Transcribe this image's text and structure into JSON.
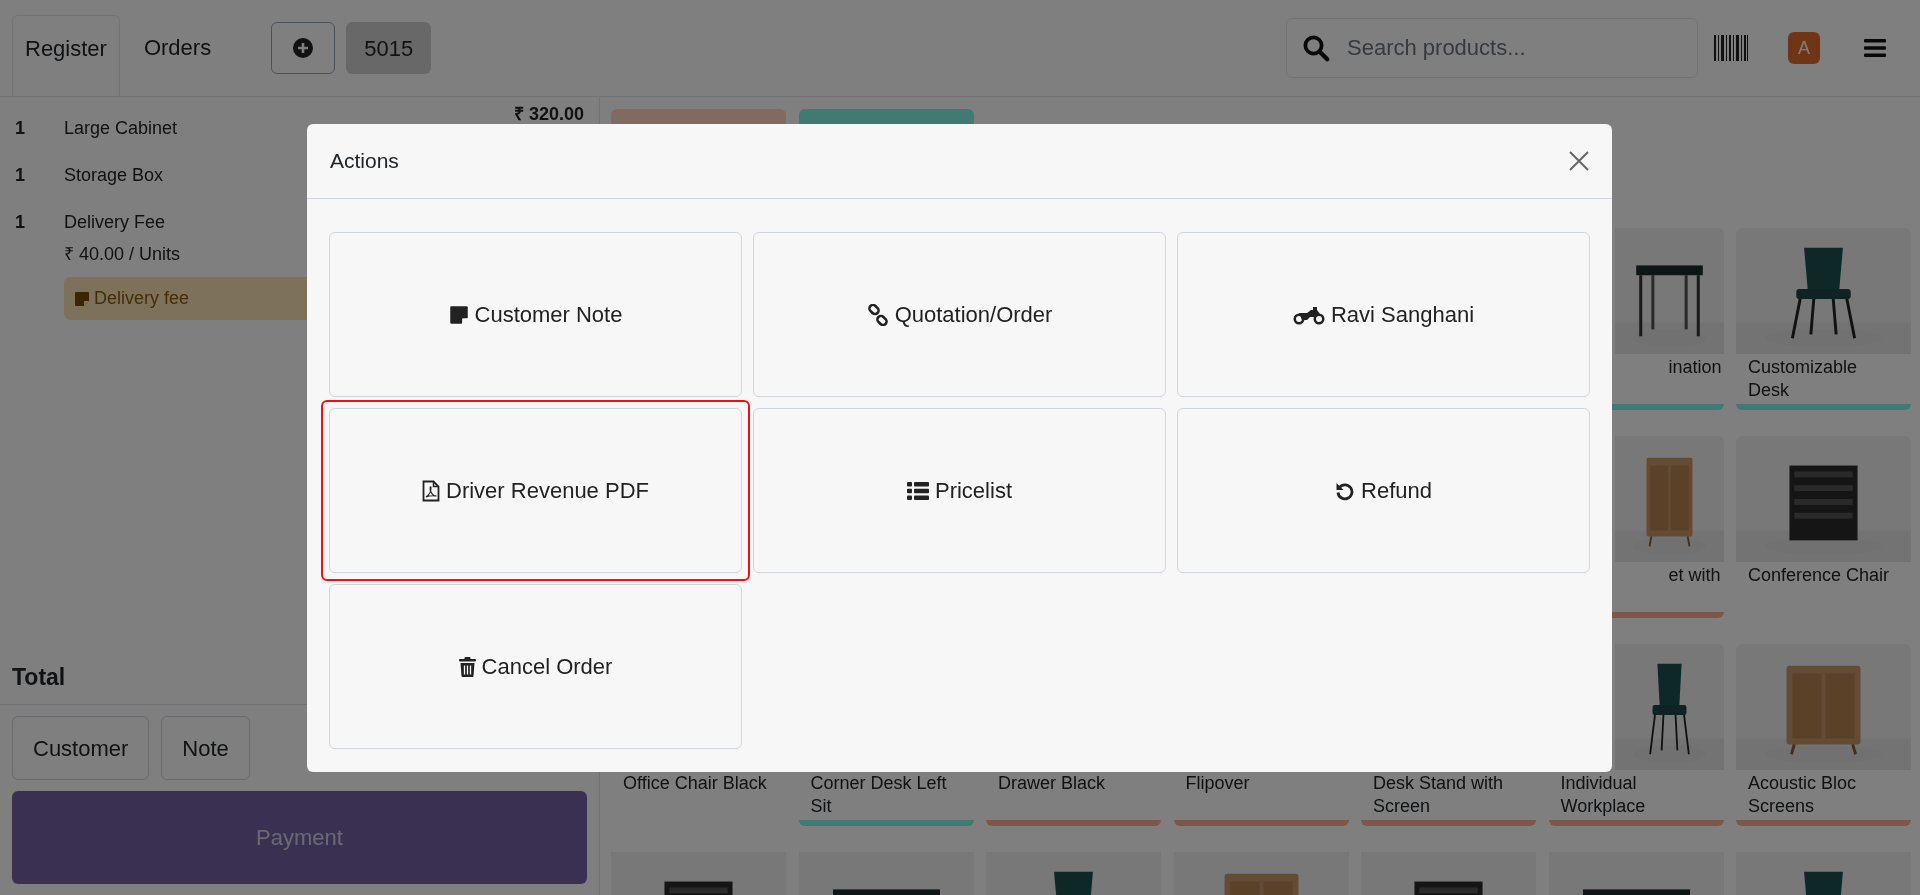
{
  "topbar": {
    "tabs": [
      {
        "label": "Register",
        "selected": true
      },
      {
        "label": "Orders",
        "selected": false
      }
    ],
    "order_tabs": [
      {
        "label": "5015",
        "selected": true
      }
    ],
    "search": {
      "placeholder": "Search products..."
    },
    "user_avatar": "A"
  },
  "order_lines": [
    {
      "quantity": "1",
      "product": "Large Cabinet",
      "price": "₹ 320.00"
    },
    {
      "quantity": "1",
      "product": "Storage Box"
    },
    {
      "quantity": "1",
      "product": "Delivery Fee",
      "unit_price": "₹ 40.00 / Units",
      "note": "Delivery fee"
    }
  ],
  "total_label": "Total",
  "order_buttons": [
    "Customer",
    "Note"
  ],
  "payment_button": "Payment",
  "categories": [
    {
      "color": "#806a62"
    },
    {
      "color": "#407a73"
    }
  ],
  "product_rows": [
    {
      "products": [
        {
          "kind": "card",
          "name": "ination",
          "clipped": true,
          "color": "#407a73"
        },
        {
          "kind": "card",
          "name": "Customizable Desk",
          "clipped": false,
          "color": "#407a73"
        }
      ]
    },
    {
      "products": [
        {
          "kind": "card",
          "name": "et with",
          "clipped": true,
          "color": "#7d5848"
        },
        {
          "kind": "card",
          "name": "Conference Chair",
          "clipped": false
        }
      ]
    },
    {
      "products": [
        {
          "kind": "card",
          "name": "Office Chair Black",
          "clipped": false
        },
        {
          "kind": "card",
          "name": "Corner Desk Left Sit",
          "clipped": false,
          "color": "#407a73"
        },
        {
          "kind": "card",
          "name": "Drawer Black",
          "clipped": false,
          "color": "#7d5848"
        },
        {
          "kind": "card",
          "name": "Flipover",
          "clipped": false,
          "color": "#7d5848"
        },
        {
          "kind": "card",
          "name": "Desk Stand with Screen",
          "clipped": false,
          "color": "#7d5848"
        },
        {
          "kind": "card",
          "name": "Individual Workplace",
          "clipped": false,
          "color": "#7d5848"
        },
        {
          "kind": "card",
          "name": "Acoustic Bloc Screens",
          "clipped": false,
          "color": "#7d5848"
        }
      ]
    },
    {
      "products": [
        {
          "kind": "image_only"
        },
        {
          "kind": "image_only"
        },
        {
          "kind": "image_only"
        },
        {
          "kind": "image_only"
        },
        {
          "kind": "image_only"
        },
        {
          "kind": "image_only"
        },
        {
          "kind": "image_only"
        }
      ]
    }
  ],
  "dialog": {
    "title": "Actions",
    "actions": [
      {
        "kind": "note",
        "label": "Customer Note",
        "highlighted": false
      },
      {
        "kind": "link",
        "label": "Quotation/Order",
        "highlighted": false
      },
      {
        "kind": "motorcycle",
        "label": "Ravi Sanghani",
        "highlighted": false
      },
      {
        "kind": "pdf",
        "label": "Driver Revenue PDF",
        "highlighted": true
      },
      {
        "kind": "list",
        "label": "Pricelist",
        "highlighted": false
      },
      {
        "kind": "undo",
        "label": "Refund",
        "highlighted": false
      },
      {
        "kind": "trash",
        "label": "Cancel Order",
        "highlighted": false
      }
    ]
  }
}
